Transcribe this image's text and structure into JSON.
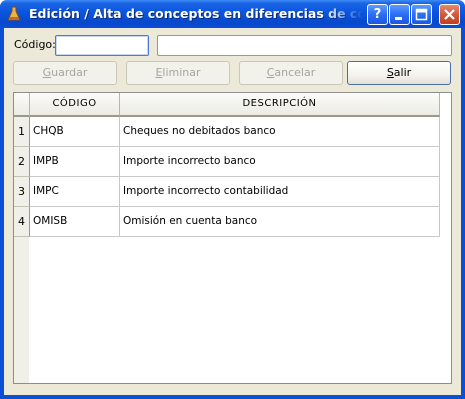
{
  "window": {
    "title": "Edición / Alta de conceptos en diferencias de conciliación",
    "help_symbol": "?",
    "minimize_symbol": "–",
    "maximize_symbol": "□",
    "close_symbol": "✕",
    "app_icon": "flask-icon"
  },
  "form": {
    "codigo_label": "Código:",
    "codigo_value": "",
    "descripcion_value": ""
  },
  "toolbar": {
    "guardar": {
      "u": "G",
      "rest": "uardar",
      "enabled": false
    },
    "eliminar": {
      "u": "E",
      "rest": "liminar",
      "enabled": false
    },
    "cancelar": {
      "u": "C",
      "rest": "ancelar",
      "enabled": false
    },
    "salir": {
      "u": "S",
      "rest": "alir",
      "enabled": true
    }
  },
  "grid": {
    "columns": [
      "CÓDIGO",
      "DESCRIPCIÓN"
    ],
    "rows": [
      {
        "n": "1",
        "codigo": "CHQB",
        "descripcion": "Cheques no debitados banco"
      },
      {
        "n": "2",
        "codigo": "IMPB",
        "descripcion": "Importe incorrecto banco"
      },
      {
        "n": "3",
        "codigo": "IMPC",
        "descripcion": "Importe incorrecto contabilidad"
      },
      {
        "n": "4",
        "codigo": "OMISB",
        "descripcion": "Omisión en cuenta banco"
      }
    ]
  },
  "colors": {
    "titlebar": "#0a55dd",
    "client": "#ece9d8",
    "close_button": "#d45a3a"
  }
}
